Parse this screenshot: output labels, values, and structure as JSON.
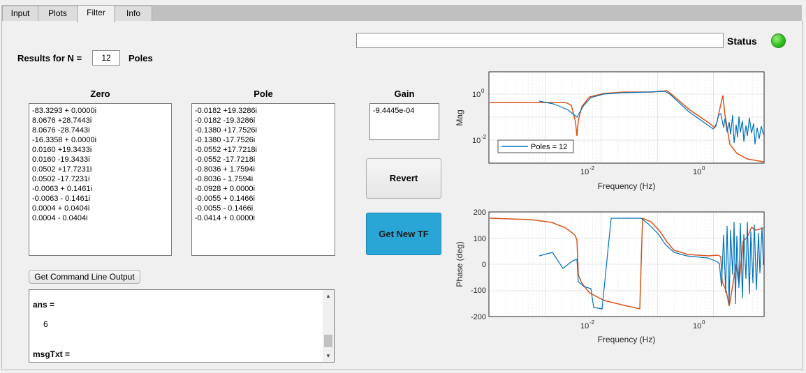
{
  "tabs": [
    {
      "label": "Input",
      "active": false
    },
    {
      "label": "Plots",
      "active": false
    },
    {
      "label": "Filter",
      "active": true
    },
    {
      "label": "Info",
      "active": false
    }
  ],
  "status": {
    "label": "Status",
    "field_value": "",
    "lamp_color": "#2fbf1f"
  },
  "results": {
    "prefix": "Results for N =",
    "n_value": "12",
    "suffix": "Poles"
  },
  "zero": {
    "header": "Zero",
    "items": [
      "-83.3293 + 0.0000i",
      "8.0676 +28.7443i",
      "8.0676 -28.7443i",
      "-16.3358 + 0.0000i",
      "0.0160 +19.3433i",
      "0.0160 -19.3433i",
      "0.0502 +17.7231i",
      "0.0502 -17.7231i",
      "-0.0063 + 0.1461i",
      "-0.0063 - 0.1461i",
      "0.0004 + 0.0404i",
      "0.0004 - 0.0404i"
    ]
  },
  "pole": {
    "header": "Pole",
    "items": [
      "-0.0182 +19.3286i",
      "-0.0182 -19.3286i",
      "-0.1380 +17.7526i",
      "-0.1380 -17.7526i",
      "-0.0552 +17.7218i",
      "-0.0552 -17.7218i",
      "-0.8036 + 1.7594i",
      "-0.8036 - 1.7594i",
      "-0.0928 + 0.0000i",
      "-0.0055 + 0.1466i",
      "-0.0055 - 0.1466i",
      "-0.0414 + 0.0000i"
    ]
  },
  "gain": {
    "header": "Gain",
    "value": "-9.4445e-04"
  },
  "buttons": {
    "revert": "Revert",
    "get_new_tf": "Get New TF",
    "cmd_output": "Get Command Line Output"
  },
  "console": {
    "line1": "ans =",
    "line2": "6",
    "line3": "msgTxt ="
  },
  "colors": {
    "series_blue": "#0072bd",
    "series_orange": "#d95319",
    "accent": "#2aa6d6"
  },
  "mag_plot": {
    "ylabel": "Mag",
    "xlabel": "Frequency (Hz)",
    "xtick_labels": [
      "10",
      "-2",
      "10",
      "0"
    ],
    "ytick_labels": [
      "10",
      "0",
      "10",
      "-2"
    ],
    "legend": "Poles = 12",
    "x_scale": "log",
    "y_scale": "log",
    "grid": true,
    "legend_position": "bottom-left"
  },
  "phase_plot": {
    "ylabel": "Phase (deg)",
    "xlabel": "Frequency (Hz)",
    "xtick_labels": [
      "10",
      "-2",
      "10",
      "0"
    ],
    "ytick_labels": [
      "200",
      "100",
      "0",
      "-100",
      "-200"
    ],
    "x_scale": "log",
    "ylim": [
      -200,
      200
    ],
    "grid": true
  }
}
